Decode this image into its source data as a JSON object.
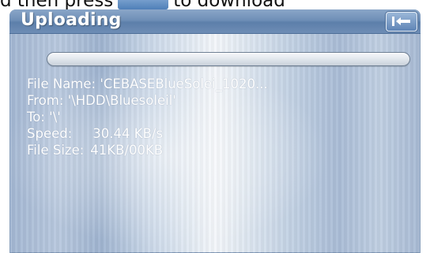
{
  "background_text": {
    "before": "d then press",
    "after": "to download"
  },
  "dialog": {
    "title": "Uploading",
    "back_button": {
      "icon": "back-arrow-icon"
    },
    "progress": {
      "value": 0
    },
    "file_name": "File Name: 'CEBASEBlueSolei_1020...",
    "from": "From: '\\HDD\\Bluesoleil'",
    "to": "To: '\\'",
    "speed_label": "Speed:",
    "speed_value": "30.44 KB/s",
    "size_label": "File Size:",
    "size_value": "41KB/00KB"
  },
  "colors": {
    "titlebar": "#6f8fb7",
    "text": "#ffffff",
    "progress_track": "#e3e8ee"
  }
}
